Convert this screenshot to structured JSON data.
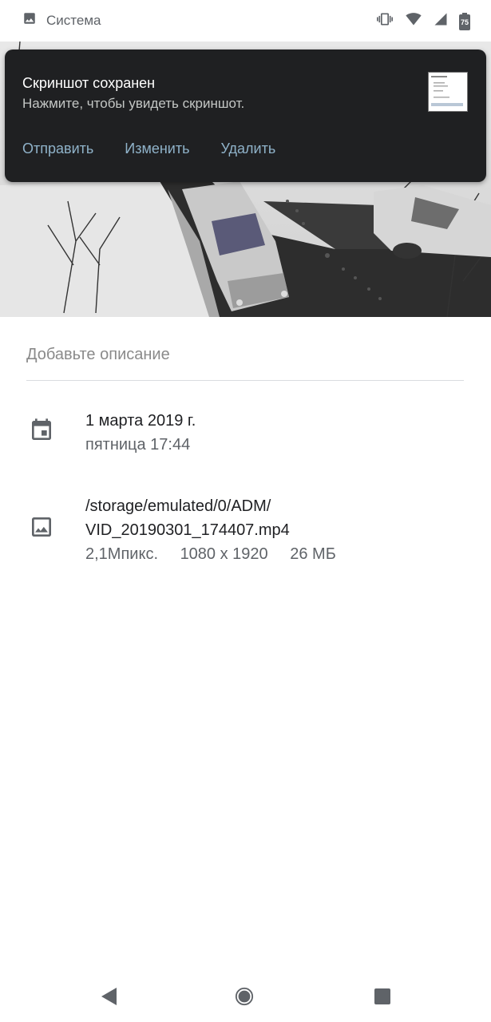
{
  "status_bar": {
    "app_icon": "image-icon",
    "app_label": "Система",
    "battery_level": "75",
    "icons": [
      "vibrate-icon",
      "wifi-icon",
      "signal-icon",
      "battery-icon"
    ]
  },
  "notification": {
    "title": "Скриншот сохранен",
    "text": "Нажмите, чтобы увидеть скриншот.",
    "actions": {
      "share": "Отправить",
      "edit": "Изменить",
      "delete": "Удалить"
    }
  },
  "description": {
    "placeholder": "Добавьте описание"
  },
  "details": {
    "date": {
      "icon": "calendar-icon",
      "primary": "1 марта 2019 г.",
      "secondary": "пятница 17:44"
    },
    "file": {
      "icon": "image-icon",
      "path_line1": "/storage/emulated/0/ADM/",
      "path_line2": "VID_20190301_174407.mp4",
      "megapixels": "2,1Мпикс.",
      "resolution": "1080 x 1920",
      "size": "26 МБ"
    }
  },
  "nav": {
    "back": "back-icon",
    "home": "home-icon",
    "recents": "recents-icon"
  },
  "colors": {
    "notification_bg": "#1f2022",
    "action_text": "#8fb2c9",
    "placeholder": "#8a8a8a",
    "icon_gray": "#5f6368"
  }
}
